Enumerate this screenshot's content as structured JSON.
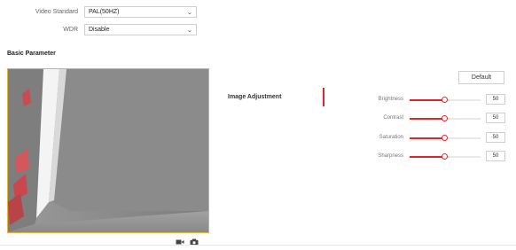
{
  "form": {
    "video_standard": {
      "label": "Video Standard",
      "value": "PAL(50HZ)"
    },
    "wdr": {
      "label": "WDR",
      "value": "Disable"
    }
  },
  "section": {
    "basic_parameter": "Basic Parameter"
  },
  "panel": {
    "default_label": "Default",
    "image_adjustment_title": "Image Adjustment",
    "sliders": [
      {
        "label": "Brightness",
        "value": "50",
        "fraction": 0.5
      },
      {
        "label": "Contrast",
        "value": "50",
        "fraction": 0.5
      },
      {
        "label": "Saturation",
        "value": "50",
        "fraction": 0.5
      },
      {
        "label": "Sharpness",
        "value": "50",
        "fraction": 0.5
      }
    ]
  },
  "video_tools": {
    "record_icon": "video-camera-icon",
    "capture_icon": "camera-icon"
  },
  "colors": {
    "accent": "#e0262b",
    "video_border": "#e9b23d"
  }
}
